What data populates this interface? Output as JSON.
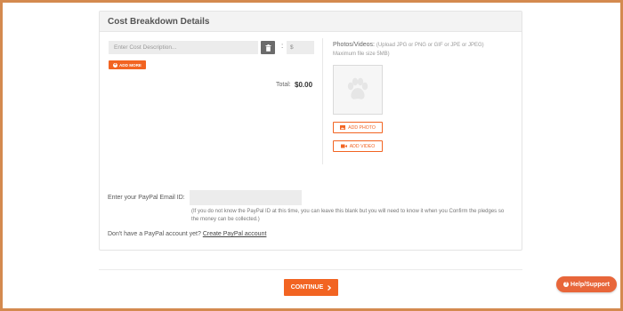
{
  "section": {
    "title": "Cost Breakdown Details"
  },
  "cost": {
    "description_placeholder": "Enter Cost Description...",
    "separator": ":",
    "currency": "$",
    "add_more_label": "ADD MORE",
    "total_label": "Total:",
    "total_value": "$0.00"
  },
  "media": {
    "title": "Photos/Videos:",
    "hint": "(Upload JPG or PNG or GIF or JPE or JPEG) Maximum file size 5MB)",
    "add_photo_label": "ADD PHOTO",
    "add_video_label": "ADD VIDEO",
    "placeholder_icon": "paw-icon"
  },
  "paypal": {
    "label": "Enter your PayPal Email ID:",
    "value": "",
    "note": "(If you do not know the PayPal ID at this time, you can leave this blank but you will need to know it when you Confirm the pledges so the money can be collected.)",
    "no_account_text": "Don't have a PayPal account yet?",
    "create_link": "Create PayPal account"
  },
  "actions": {
    "continue_label": "CONTINUE",
    "continue_icon": "chevron-right-icon",
    "help_label": "Help/Support"
  },
  "colors": {
    "accent": "#f26422",
    "frame": "#d48a4f",
    "help": "#e8663a"
  }
}
